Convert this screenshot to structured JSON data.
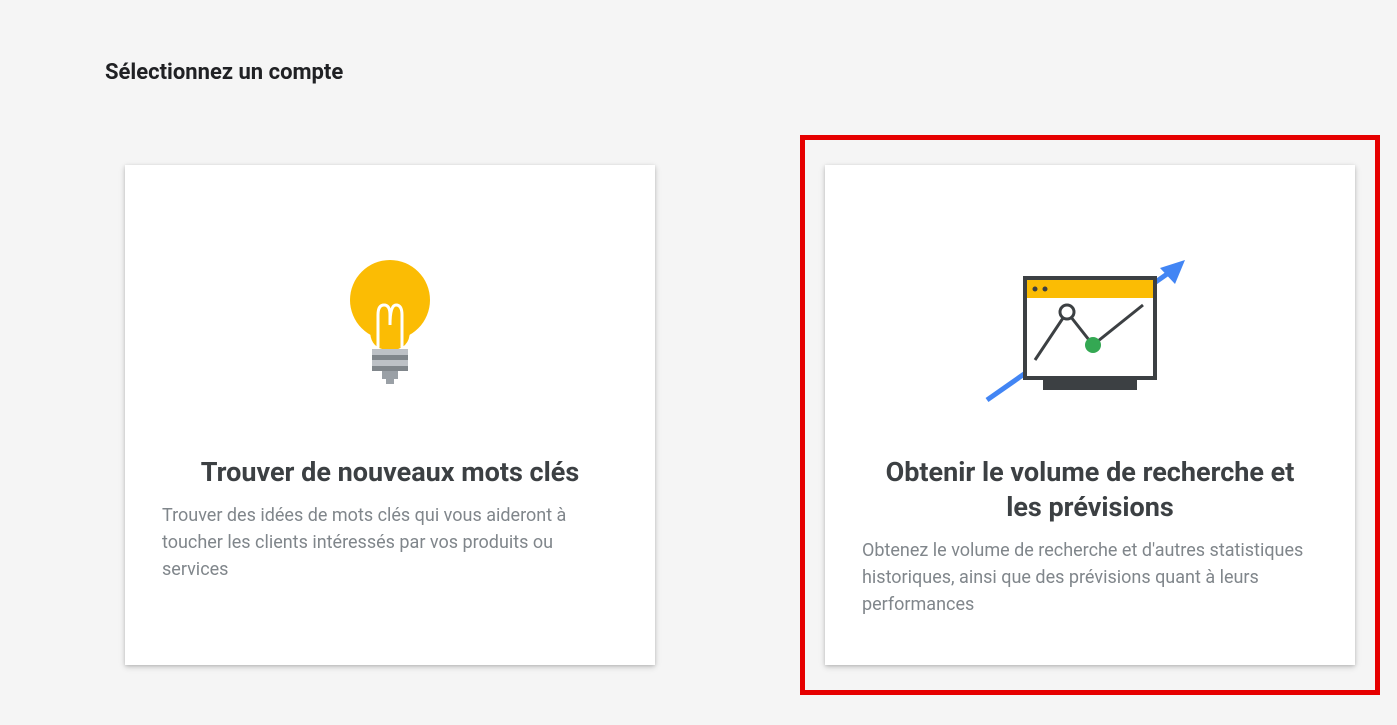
{
  "page": {
    "title": "Sélectionnez un compte"
  },
  "cards": [
    {
      "title": "Trouver de nouveaux mots clés",
      "description": "Trouver des idées de mots clés qui vous aideront à toucher les clients intéressés par vos produits ou services",
      "icon": "lightbulb-icon",
      "highlighted": false
    },
    {
      "title": "Obtenir le volume de recherche et les prévisions",
      "description": "Obtenez le volume de recherche et d'autres statistiques historiques, ainsi que des prévisions quant à leurs performances",
      "icon": "chart-arrow-icon",
      "highlighted": true
    }
  ],
  "colors": {
    "highlight_border": "#e60000",
    "icon_yellow": "#f9ab00",
    "icon_yellow_light": "#fbbc04",
    "icon_blue": "#4285f4",
    "icon_green": "#34a853",
    "icon_grey": "#9aa0a6",
    "icon_dark": "#3c4043"
  }
}
